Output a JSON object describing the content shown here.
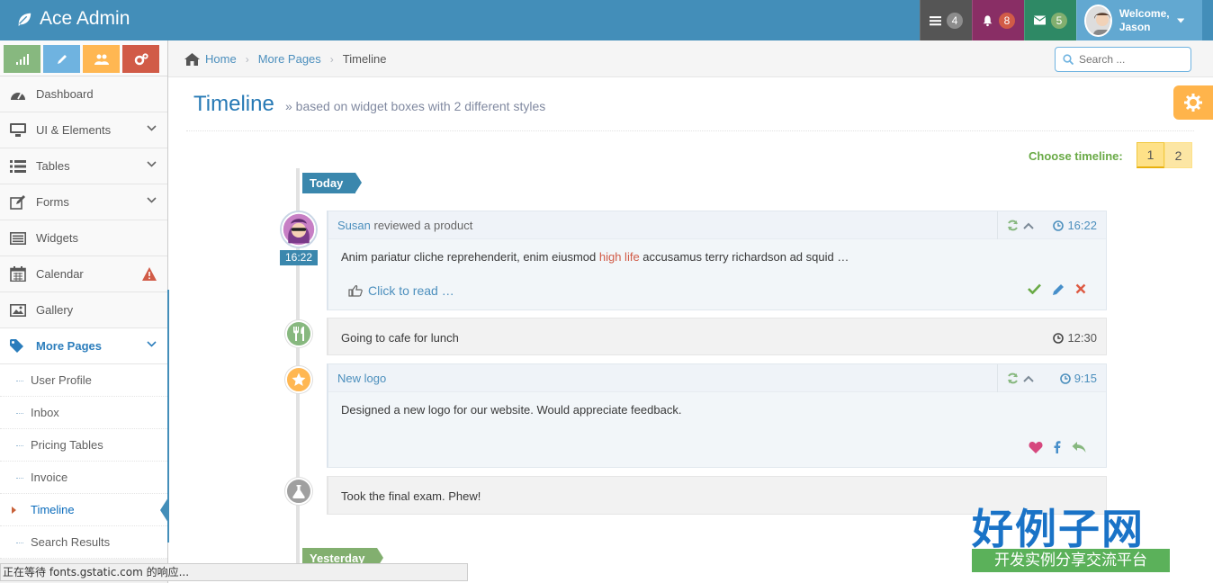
{
  "app": {
    "title": "Ace Admin"
  },
  "navbar": {
    "tasks_count": "4",
    "notifications_count": "8",
    "messages_count": "5",
    "welcome_label": "Welcome,",
    "user_name": "Jason"
  },
  "sidebar": {
    "items": [
      {
        "label": "Dashboard"
      },
      {
        "label": "UI & Elements"
      },
      {
        "label": "Tables"
      },
      {
        "label": "Forms"
      },
      {
        "label": "Widgets"
      },
      {
        "label": "Calendar"
      },
      {
        "label": "Gallery"
      },
      {
        "label": "More Pages"
      }
    ],
    "sub_items": [
      {
        "label": "User Profile"
      },
      {
        "label": "Inbox"
      },
      {
        "label": "Pricing Tables"
      },
      {
        "label": "Invoice"
      },
      {
        "label": "Timeline"
      },
      {
        "label": "Search Results"
      }
    ]
  },
  "breadcrumb": {
    "home": "Home",
    "parent": "More Pages",
    "current": "Timeline"
  },
  "search": {
    "placeholder": "Search ..."
  },
  "header": {
    "title": "Timeline",
    "subtitle": "» based on widget boxes with 2 different styles"
  },
  "chooser": {
    "label": "Choose timeline:",
    "page1": "1",
    "page2": "2"
  },
  "timeline": {
    "today_label": "Today",
    "yesterday_label": "Yesterday",
    "items": [
      {
        "author": "Susan",
        "action": " reviewed a product",
        "time": "16:22",
        "avatar_time": "16:22",
        "body_pre": "Anim pariatur cliche reprehenderit, enim eiusmod ",
        "body_hl": "high life",
        "body_post": " accusamus terry richardson ad squid …",
        "read_more": "Click to read …"
      },
      {
        "text": "Going to cafe for lunch",
        "time": "12:30"
      },
      {
        "title": "New logo",
        "time": "9:15",
        "body": "Designed a new logo for our website. Would appreciate feedback."
      },
      {
        "text": "Took the final exam. Phew!"
      }
    ]
  },
  "statusbar": {
    "text": "正在等待 fonts.gstatic.com 的响应..."
  },
  "watermark": {
    "big": "好例子网",
    "small": "开发实例分享交流平台"
  },
  "colors": {
    "navbar": "#438eb9",
    "accent": "#2679b5",
    "purple": "#892e65",
    "green": "#2e8965"
  }
}
